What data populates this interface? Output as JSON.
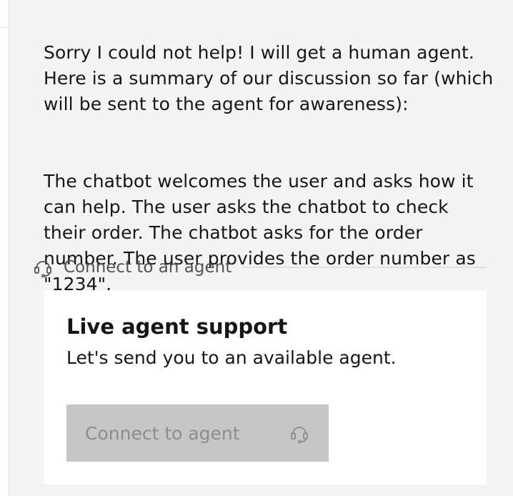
{
  "chat": {
    "message_paragraphs": [
      "Sorry I could not help! I will get a human agent.\nHere is a summary of our discussion so far (which\nwill be sent to the agent for awareness):",
      "The chatbot welcomes the user and asks how it\ncan help. The user asks the chatbot to check\ntheir order. The chatbot asks for the order\nnumber. The user provides the order number as\n\"1234\"."
    ],
    "divider_label": "Connect to an agent",
    "divider_icon": "headset-icon"
  },
  "live_agent_card": {
    "title": "Live agent support",
    "body": "Let's send you to an available agent.",
    "button_label": "Connect to agent",
    "button_icon": "headset-icon"
  },
  "colors": {
    "panel_background": "#f4f4f4",
    "card_background": "#ffffff",
    "text_primary": "#161616",
    "text_secondary": "#525252",
    "button_disabled_background": "#c6c6c6",
    "button_disabled_text": "#8d8d8d"
  }
}
